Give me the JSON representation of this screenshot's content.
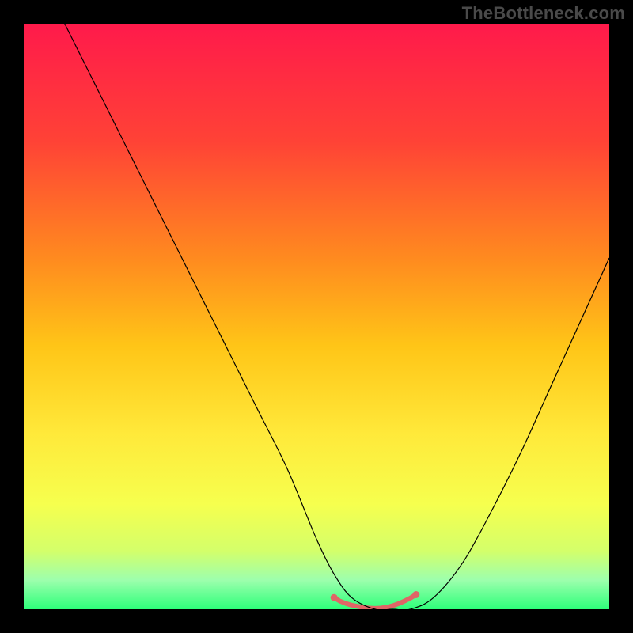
{
  "watermark": "TheBottleneck.com",
  "chart_data": {
    "type": "line",
    "title": "",
    "xlabel": "",
    "ylabel": "",
    "xlim": [
      0,
      100
    ],
    "ylim": [
      0,
      100
    ],
    "grid": false,
    "legend": false,
    "background_gradient": {
      "stops": [
        {
          "pos": 0.0,
          "color": "#ff1a4b"
        },
        {
          "pos": 0.2,
          "color": "#ff4236"
        },
        {
          "pos": 0.4,
          "color": "#ff8a1f"
        },
        {
          "pos": 0.55,
          "color": "#ffc517"
        },
        {
          "pos": 0.7,
          "color": "#ffe93a"
        },
        {
          "pos": 0.82,
          "color": "#f6ff4e"
        },
        {
          "pos": 0.9,
          "color": "#d4ff6a"
        },
        {
          "pos": 0.95,
          "color": "#9dffad"
        },
        {
          "pos": 1.0,
          "color": "#2dff7a"
        }
      ]
    },
    "series": [
      {
        "name": "curve",
        "color": "#000000",
        "width": 1.2,
        "x": [
          7,
          10,
          15,
          20,
          25,
          30,
          35,
          40,
          45,
          50,
          53,
          56,
          60,
          63,
          66,
          70,
          75,
          80,
          85,
          90,
          95,
          100
        ],
        "y": [
          100,
          94,
          84,
          74,
          64,
          54,
          44,
          34,
          24,
          12,
          6,
          2,
          0,
          0,
          0,
          2,
          8,
          17,
          27,
          38,
          49,
          60
        ]
      }
    ],
    "highlight": {
      "name": "bottom-band",
      "color": "#e06666",
      "width": 6,
      "x": [
        53,
        54,
        55,
        56,
        57,
        58,
        59,
        60,
        61,
        62,
        63,
        64,
        65,
        66,
        67
      ],
      "y": [
        2.0,
        1.4,
        1.0,
        0.7,
        0.5,
        0.3,
        0.2,
        0.15,
        0.2,
        0.35,
        0.6,
        0.95,
        1.4,
        1.9,
        2.5
      ],
      "endpoints": [
        {
          "x": 53,
          "y": 2.0
        },
        {
          "x": 67,
          "y": 2.5
        }
      ]
    }
  }
}
